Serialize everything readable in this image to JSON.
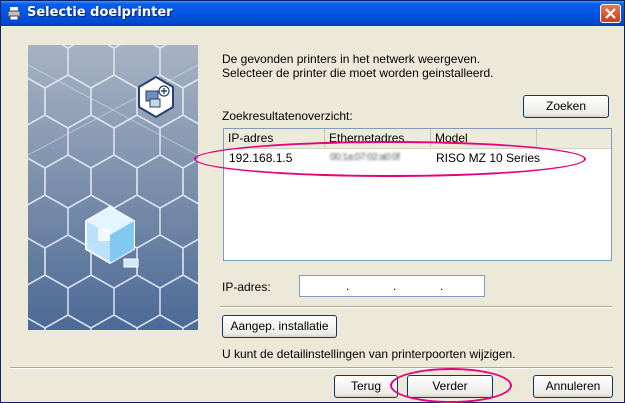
{
  "window": {
    "title": "Selectie doelprinter"
  },
  "intro": {
    "line1": "De gevonden printers in het netwerk weergeven.",
    "line2": "Selecteer de printer die moet worden geinstalleerd."
  },
  "search": {
    "label": "Zoekresultatenoverzicht:",
    "button": "Zoeken"
  },
  "results": {
    "columns": [
      "IP-adres",
      "Ethernetadres",
      "Model"
    ],
    "rows": [
      {
        "ip": "192.168.1.5",
        "ethernet": "00:1a:07:02:a0:0f",
        "model": "RISO MZ 10 Series"
      }
    ]
  },
  "ip_field": {
    "label": "IP-adres:",
    "dots": [
      ".",
      ".",
      "."
    ]
  },
  "custom_install": {
    "button": "Aangep. installatie",
    "hint": "U kunt de detailinstellingen van printerpoorten wijzigen."
  },
  "footer": {
    "back": "Terug",
    "next": "Verder",
    "cancel": "Annuleren"
  },
  "colors": {
    "highlight": "#e6007e",
    "titlebar": "#0054e3",
    "dialog_bg": "#ece9d8"
  }
}
